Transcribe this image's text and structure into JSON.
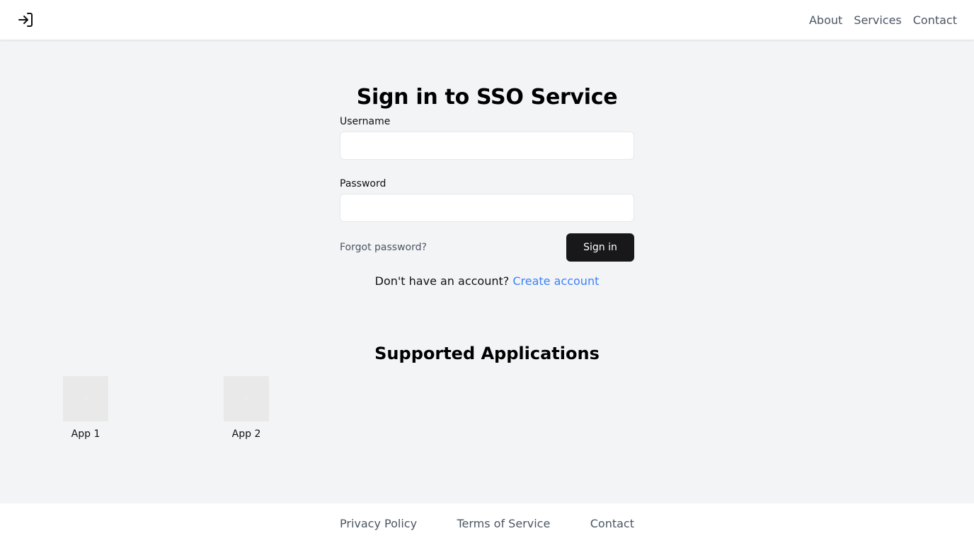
{
  "header": {
    "logo_icon": "login-arrow-icon",
    "nav": [
      {
        "label": "About"
      },
      {
        "label": "Services"
      },
      {
        "label": "Contact"
      }
    ]
  },
  "signin": {
    "title": "Sign in to SSO Service",
    "username_label": "Username",
    "username_value": "",
    "password_label": "Password",
    "password_value": "",
    "forgot_label": "Forgot password?",
    "submit_label": "Sign in",
    "no_account_text": "Don't have an account?",
    "create_account_label": "Create account"
  },
  "apps": {
    "title": "Supported Applications",
    "items": [
      {
        "name": "App 1"
      },
      {
        "name": "App 2"
      }
    ]
  },
  "footer": {
    "links": [
      {
        "label": "Privacy Policy"
      },
      {
        "label": "Terms of Service"
      },
      {
        "label": "Contact"
      }
    ]
  },
  "colors": {
    "page_background": "#f3f4f6",
    "primary_button": "#18181b",
    "link_accent": "#3b82f6",
    "muted_text": "#4b5563"
  }
}
